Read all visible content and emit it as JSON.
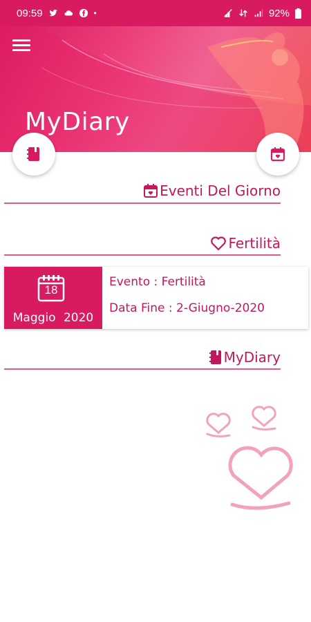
{
  "status_bar": {
    "time": "09:59",
    "battery": "92%"
  },
  "header": {
    "title": "MyDiary"
  },
  "sections": {
    "events_today": {
      "title": "Eventi Del Giorno",
      "icon": "calendar-heart-icon"
    },
    "fertility": {
      "title": "Fertilità",
      "icon": "heart-outline-icon"
    },
    "mydiary": {
      "title": "MyDiary",
      "icon": "diary-book-icon"
    }
  },
  "event_card": {
    "day": "18",
    "month": "Maggio",
    "year": "2020",
    "event_line": "Evento : Fertilità",
    "end_date_line": "Data Fine : 2-Giugno-2020"
  },
  "colors": {
    "primary": "#d81b60",
    "accent_text": "#c2185b",
    "divider": "#e05a91",
    "hearts": "#f2a2bd"
  }
}
